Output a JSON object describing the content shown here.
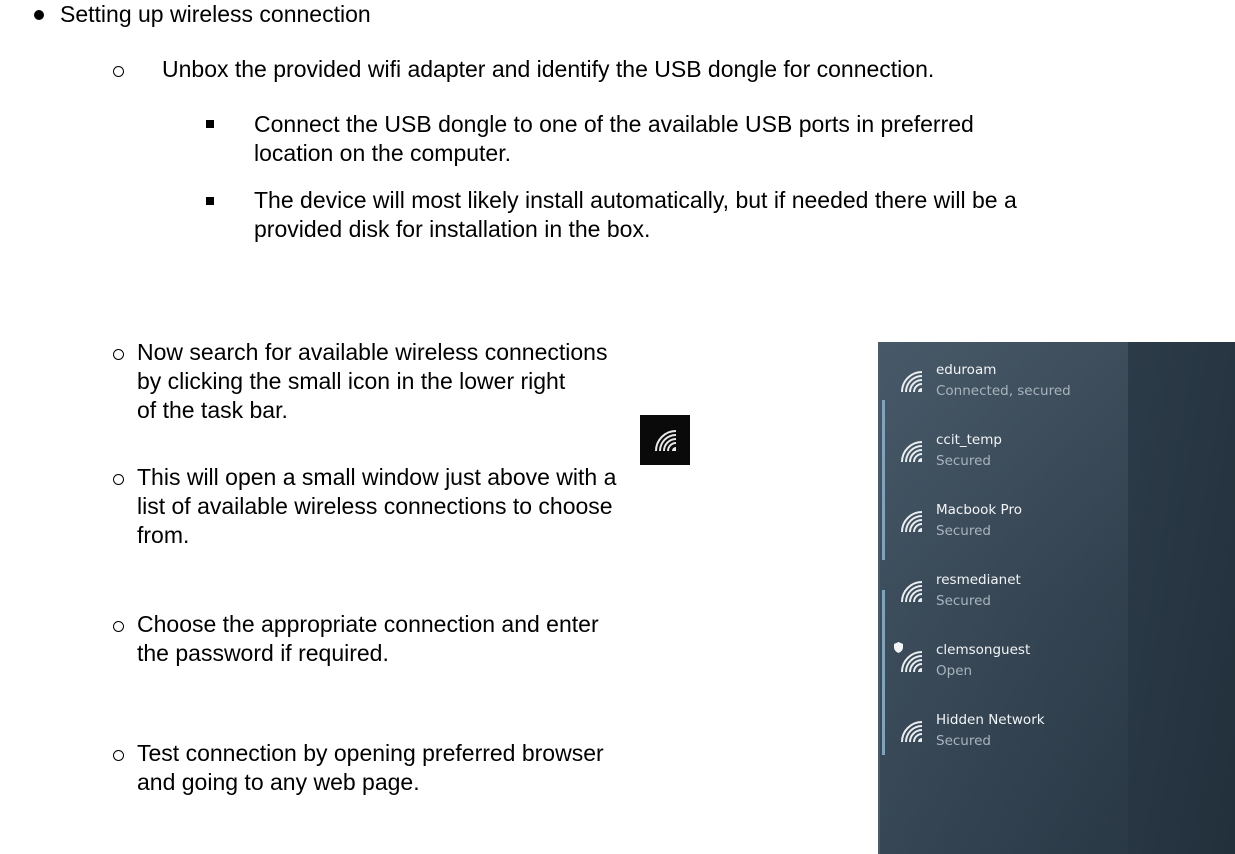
{
  "doc": {
    "heading": "Setting up wireless connection",
    "step_unbox": "Unbox the provided wifi adapter and identify the USB dongle for connection.",
    "sub_connect_l1": "Connect the USB dongle to one of the available USB ports in preferred",
    "sub_connect_l2": "location on the computer.",
    "sub_install_l1": "The device will most likely install automatically, but if needed there will be a",
    "sub_install_l2": "provided disk for installation in the box.",
    "step_search_l1": "Now search for available wireless connections",
    "step_search_l2": "by clicking the small icon in the lower right",
    "step_search_l3": "of the task bar.",
    "step_open_l1": "This will open a small window just above with a",
    "step_open_l2": "list of available wireless connections to choose",
    "step_open_l3": "from.",
    "step_choose_l1": "Choose the appropriate connection and enter",
    "step_choose_l2": "the password if required.",
    "step_test_l1": "Test connection by opening preferred browser",
    "step_test_l2": "and going to any web page."
  },
  "wifi_panel": {
    "networks": [
      {
        "name": "eduroam",
        "status": "Connected, secured"
      },
      {
        "name": "ccit_temp",
        "status": "Secured"
      },
      {
        "name": "Macbook Pro",
        "status": "Secured"
      },
      {
        "name": "resmedianet",
        "status": "Secured"
      },
      {
        "name": "clemsonguest",
        "status": "Open"
      },
      {
        "name": "Hidden Network",
        "status": "Secured"
      }
    ]
  },
  "icons": {
    "taskbar": "wifi-icon",
    "network": "wifi-icon",
    "warning": "shield-icon"
  },
  "colors": {
    "panel_bg": "#2f3e4c",
    "network_name": "#f2f4f6",
    "network_status": "#a9b4bd",
    "active_indicator": "#7da3bf"
  }
}
